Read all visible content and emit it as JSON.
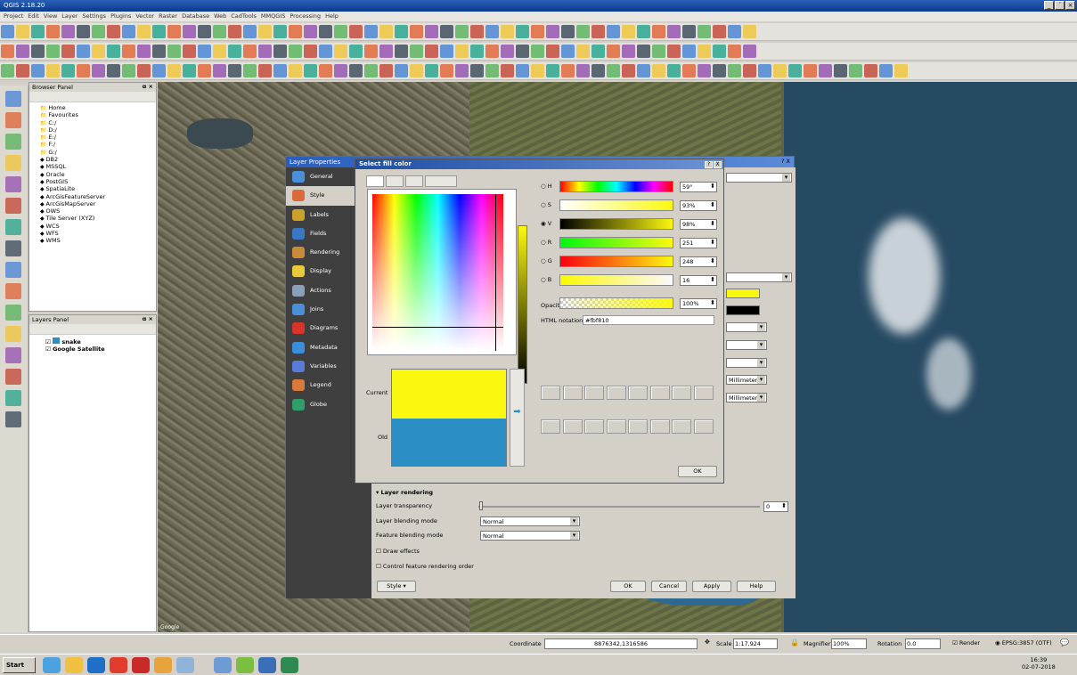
{
  "window": {
    "title": "QGIS 2.18.20",
    "controls": [
      "_",
      "´",
      "×"
    ]
  },
  "menubar": [
    "Project",
    "Edit",
    "View",
    "Layer",
    "Settings",
    "Plugins",
    "Vector",
    "Raster",
    "Database",
    "Web",
    "CadTools",
    "MMQGIS",
    "Processing",
    "Help"
  ],
  "browser_panel": {
    "title": "Browser Panel",
    "items": [
      "Home",
      "Favourites",
      "C:/",
      "D:/",
      "E:/",
      "F:/",
      "G:/",
      "DB2",
      "MSSQL",
      "Oracle",
      "PostGIS",
      "SpatiaLite",
      "ArcGisFeatureServer",
      "ArcGisMapServer",
      "OWS",
      "Tile Server (XYZ)",
      "WCS",
      "WFS",
      "WMS"
    ]
  },
  "layers_panel": {
    "title": "Layers Panel",
    "layers": [
      {
        "name": "snake",
        "checked": true
      },
      {
        "name": "Google Satellite",
        "checked": true
      }
    ]
  },
  "layer_properties": {
    "title": "Layer Properties",
    "nav": [
      "General",
      "Style",
      "Labels",
      "Fields",
      "Rendering",
      "Display",
      "Actions",
      "Joins",
      "Diagrams",
      "Metadata",
      "Variables",
      "Legend",
      "Globe"
    ],
    "selected_nav": "Style",
    "help": "?",
    "close": "X",
    "right_units": [
      "Millimeter",
      "Millimeter"
    ],
    "layer_rendering": {
      "heading": "Layer rendering",
      "transparency_label": "Layer transparency",
      "transparency_value": "0",
      "layer_blending_label": "Layer blending mode",
      "layer_blending_value": "Normal",
      "feature_blending_label": "Feature blending mode",
      "feature_blending_value": "Normal",
      "draw_effects": "Draw effects",
      "control_order": "Control feature rendering order"
    },
    "buttons": {
      "style": "Style",
      "ok": "OK",
      "cancel": "Cancel",
      "apply": "Apply",
      "help": "Help"
    }
  },
  "color_dialog": {
    "title": "Select fill color",
    "help": "?",
    "close": "X",
    "channels": [
      {
        "label": "H",
        "value": "59°"
      },
      {
        "label": "S",
        "value": "93%"
      },
      {
        "label": "V",
        "value": "98%",
        "selected": true
      },
      {
        "label": "R",
        "value": "251"
      },
      {
        "label": "G",
        "value": "248"
      },
      {
        "label": "B",
        "value": "16"
      }
    ],
    "opacity_label": "Opacity",
    "opacity_value": "100%",
    "html_label": "HTML notation",
    "html_value": "#fbf810",
    "current_label": "Current",
    "old_label": "Old",
    "current_color": "#fbf810",
    "old_color": "#2b8ec4",
    "ok": "OK"
  },
  "statusbar": {
    "coordinate_label": "Coordinate",
    "coordinate": "8876342,1316586",
    "scale_label": "Scale",
    "scale": "1:17,924",
    "magnifier_label": "Magnifier",
    "magnifier": "100%",
    "rotation_label": "Rotation",
    "rotation": "0.0",
    "render_label": "Render",
    "crs": "EPSG:3857 (OTF)"
  },
  "map": {
    "google_label": "Google"
  },
  "taskbar": {
    "start": "Start",
    "time": "16:39",
    "date": "02-07-2018"
  }
}
